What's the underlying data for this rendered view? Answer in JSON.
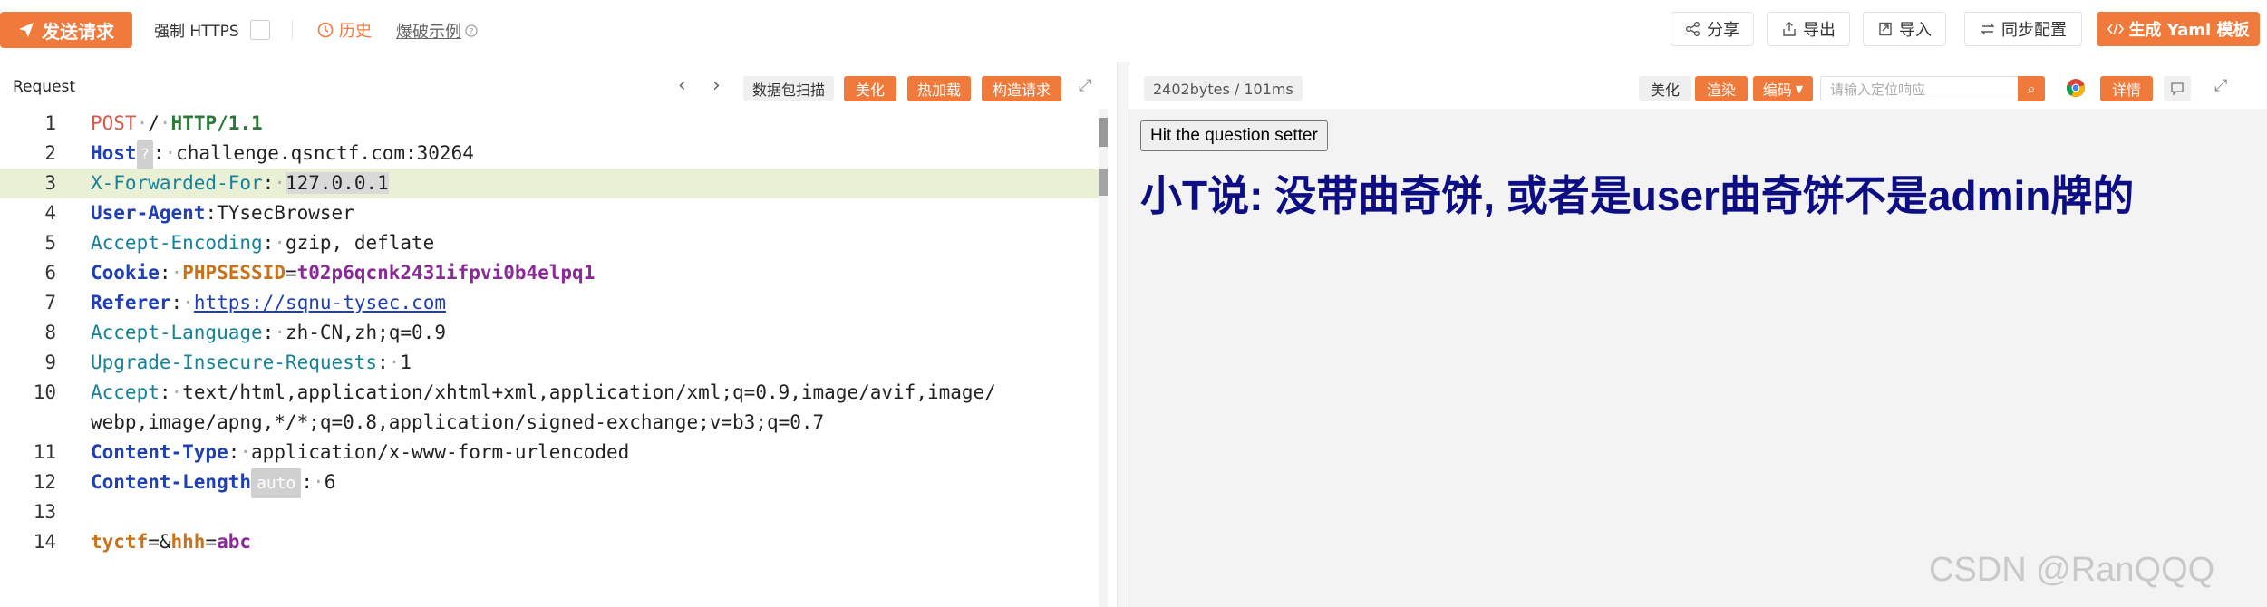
{
  "toolbar": {
    "send_label": "发送请求",
    "force_https_label": "强制 HTTPS",
    "history_label": "历史",
    "example_label": "爆破示例",
    "share_label": "分享",
    "export_label": "导出",
    "import_label": "导入",
    "sync_label": "同步配置",
    "yaml_label": "生成 Yaml 模板"
  },
  "request_panel": {
    "title": "Request",
    "scan_label": "数据包扫描",
    "beautify_label": "美化",
    "hotload_label": "热加载",
    "construct_label": "构造请求"
  },
  "response_panel": {
    "info": "2402bytes / 101ms",
    "beautify_label": "美化",
    "render_label": "渲染",
    "encode_label": "编码",
    "search_placeholder": "请输入定位响应",
    "details_label": "详情",
    "button_label": "Hit the question setter",
    "message": "小T说: 没带曲奇饼, 或者是user曲奇饼不是admin牌的"
  },
  "request_lines": {
    "l1": {
      "num": "1",
      "method": "POST",
      "path": "/",
      "proto": "HTTP/1.1"
    },
    "l2": {
      "num": "2",
      "name": "Host",
      "badge": "?",
      "value": "challenge.qsnctf.com:30264"
    },
    "l3": {
      "num": "3",
      "name": "X-Forwarded-For",
      "value": "127.0.0.1"
    },
    "l4": {
      "num": "4",
      "name": "User-Agent",
      "value": "TYsecBrowser"
    },
    "l5": {
      "num": "5",
      "name": "Accept-Encoding",
      "value": "gzip, deflate"
    },
    "l6": {
      "num": "6",
      "name": "Cookie",
      "cookie_name": "PHPSESSID",
      "cookie_value": "t02p6qcnk2431ifpvi0b4elpq1"
    },
    "l7": {
      "num": "7",
      "name": "Referer",
      "value": "https://sqnu-tysec.com"
    },
    "l8": {
      "num": "8",
      "name": "Accept-Language",
      "value": "zh-CN,zh;q=0.9"
    },
    "l9": {
      "num": "9",
      "name": "Upgrade-Insecure-Requests",
      "value": "1"
    },
    "l10": {
      "num": "10",
      "name": "Accept",
      "value": "text/html,application/xhtml+xml,application/xml;q=0.9,image/avif,image/",
      "value_cont": "webp,image/apng,*/*;q=0.8,application/signed-exchange;v=b3;q=0.7"
    },
    "l11": {
      "num": "11",
      "name": "Content-Type",
      "value": "application/x-www-form-urlencoded"
    },
    "l12": {
      "num": "12",
      "name": "Content-Length",
      "badge": "auto",
      "value": "6"
    },
    "l13": {
      "num": "13"
    },
    "l14": {
      "num": "14",
      "k1": "tyctf",
      "eq1": "=&",
      "k2": "hhh",
      "eq2": "=",
      "v2": "abc"
    }
  },
  "watermark": "CSDN @RanQQQ",
  "colors": {
    "accent": "#f07a3b",
    "heading": "#0e0e84"
  }
}
